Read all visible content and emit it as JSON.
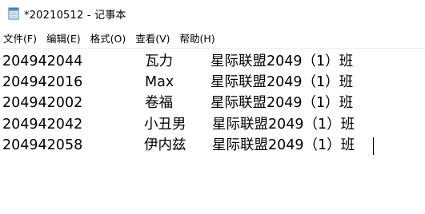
{
  "window": {
    "title": "*20210512 - 记事本",
    "icon": "notepad-icon"
  },
  "menu": [
    {
      "label": "文件(F)"
    },
    {
      "label": "编辑(E)"
    },
    {
      "label": "格式(O)"
    },
    {
      "label": "查看(V)"
    },
    {
      "label": "帮助(H)"
    }
  ],
  "document": {
    "rows": [
      {
        "id": "204942044",
        "name": "瓦力",
        "class": "星际联盟2049（1）班"
      },
      {
        "id": "204942016",
        "name": "Max",
        "class": "星际联盟2049（1）班"
      },
      {
        "id": "204942002",
        "name": "卷福",
        "class": "星际联盟2049（1）班"
      },
      {
        "id": "204942042",
        "name": "小丑男",
        "class": "星际联盟2049（1）班"
      },
      {
        "id": "204942058",
        "name": "伊内兹",
        "class": "星际联盟2049（1）班"
      }
    ]
  }
}
